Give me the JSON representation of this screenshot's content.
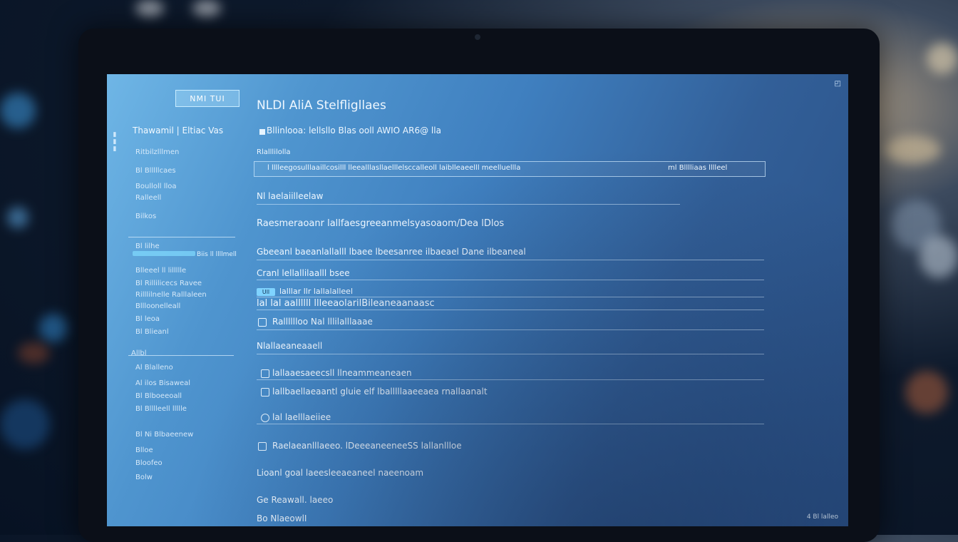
{
  "sidebar": {
    "brand": "NMI TUI",
    "title": "Thawamil  |  Eltiac  Vas",
    "items_top": [
      "Ritbilzlllmen",
      "Bl Blllllcaes",
      "Boulloll lloa",
      "Ralleell",
      "Bilkos"
    ],
    "highlight_item": "Bl lilhe",
    "highlight_tail": "Biis ll llllmell",
    "items_mid": [
      "Blleeel ll lillllle",
      "Bl Rillilicecs Ravee",
      "Rilllilnelle Ralllaleen",
      "Bllloonelleall",
      "Bl leoa",
      "Bl  Blieanl"
    ],
    "section2": "Allbl",
    "items_bottom": [
      "Al  Blalleno",
      "Al ilos Bisaweal",
      "Bl Blboeeoall",
      "Bl Blllleell llllle",
      "Bl Ni Blbaeenew",
      "Blloe",
      "Bloofeo",
      "Bolw"
    ]
  },
  "main": {
    "heading": "NLDI  AliA  Stelfligllaes",
    "subheading": "Bllinlooa:   lellsllo  Blas   ooll AWIO  AR6@  lla",
    "field1_label": "Rlalllilolla",
    "field1_value": "l  lllleegosulllaaillcosilll  lleealllasllaelllelsccalleoll laiblleaeelll meelluellla",
    "field1_tail": "ml Blllliaas lllleel",
    "field2_label": "Nl  laelaiilleelaw",
    "line3": "Raesmeraoanr  lallfaesgreeanmelsyasoaom/Dea lDlos",
    "line4": "Gbeeanl baeanlallalll lbaee  lbeesanree ilbaeael Dane ilbeaneal",
    "field3_label": "Cranl  lellallilaalll bsee",
    "badge_text": "Ull",
    "field4_label": "lalllar  llr  lallalalleel",
    "line5": "lal  lal aallllll  llleeaolarilBileaneaanaasc",
    "checkbox1_label": "Ralllllloo  Nal lllilalllaaae",
    "section_label": "Nlallaeaneaaell",
    "row1_label": "lallaaesaeecsll  llneammeaneaen",
    "row2_label": "lallbaellaeaantl  gluie elf  lballlllaaeeaea rnallaanalt",
    "row3_label": "lal laelllaeiiee",
    "row4_label": "Raelaeanlllaeeo.    lDeeeaneeneeSS  lallanllloe",
    "line6": "Lioanl   goal  laeesleeaeaneel  naeenoam",
    "line7": "Ge  Reawall.      laeeo",
    "line8": "Bo  NlaeowlI",
    "footer": "4  Bl  lalleo",
    "corner_glyph": "◰"
  },
  "colors": {
    "screen_light": "#6fb6e6",
    "screen_dark": "#294f84",
    "bezel": "#0b0f18",
    "highlight": "#7fd3ff"
  }
}
